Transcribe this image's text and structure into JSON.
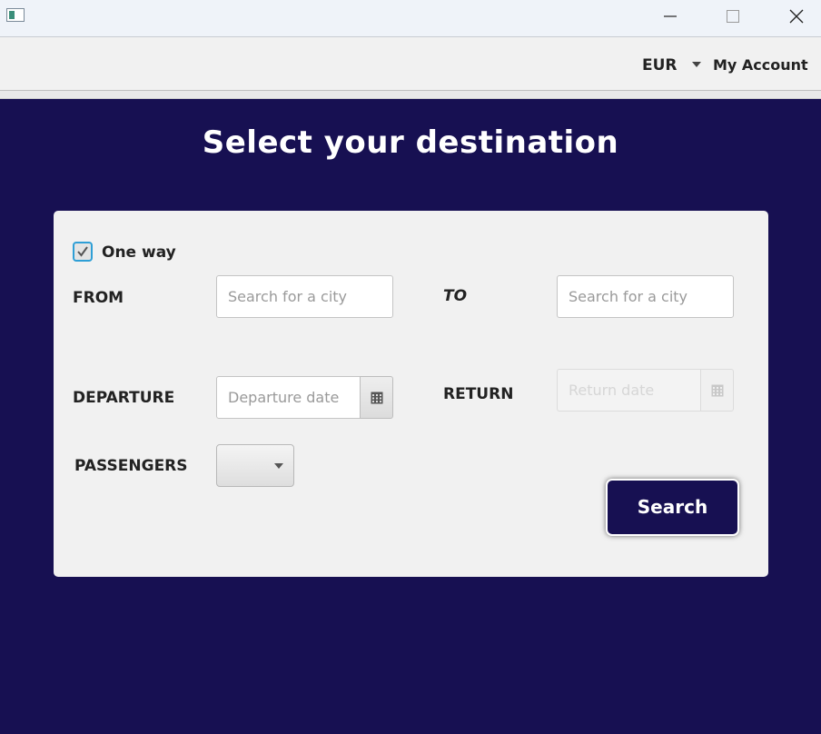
{
  "header": {
    "currency": "EUR",
    "account_label": "My Account"
  },
  "page": {
    "title": "Select your destination"
  },
  "form": {
    "one_way_label": "One way",
    "one_way_checked": true,
    "from_label": "FROM",
    "from_placeholder": "Search for a city",
    "to_label": "TO",
    "to_placeholder": "Search for a city",
    "departure_label": "DEPARTURE",
    "departure_placeholder": "Departure date",
    "return_label": "RETURN",
    "return_placeholder": "Return date",
    "passengers_label": "PASSENGERS",
    "search_label": "Search"
  },
  "colors": {
    "background": "#171052",
    "card": "#f1f1f1",
    "accent": "#2f9fd6"
  },
  "icons": [
    "app-icon",
    "minimize-icon",
    "maximize-icon",
    "close-icon",
    "chevron-down-icon",
    "checkmark-icon",
    "calendar-icon"
  ]
}
